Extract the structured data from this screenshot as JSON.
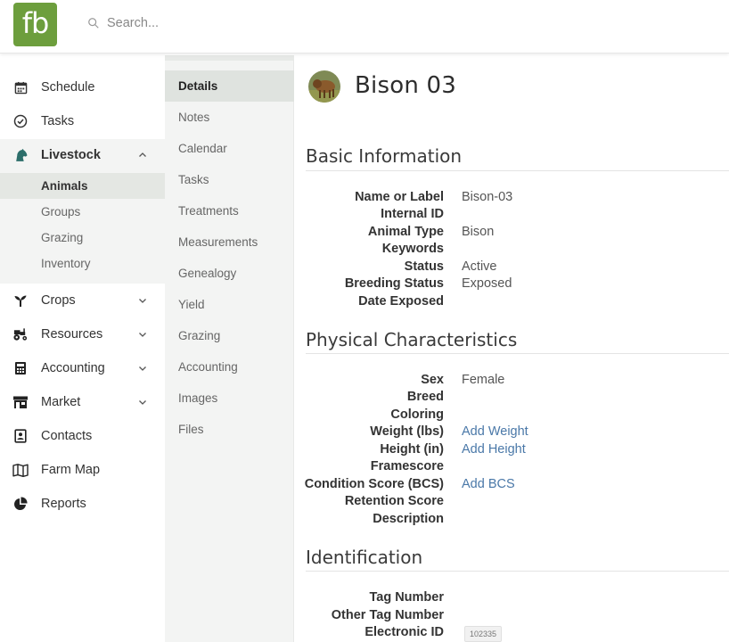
{
  "brand": {
    "logo_text": "fb",
    "color": "#6d9e3d"
  },
  "search": {
    "placeholder": "Search..."
  },
  "nav": {
    "items": [
      {
        "label": "Schedule",
        "icon": "calendar-icon"
      },
      {
        "label": "Tasks",
        "icon": "check-circle-icon"
      },
      {
        "label": "Livestock",
        "icon": "horse-head-icon",
        "expanded": true
      },
      {
        "label": "Crops",
        "icon": "sprout-icon"
      },
      {
        "label": "Resources",
        "icon": "tractor-icon"
      },
      {
        "label": "Accounting",
        "icon": "calculator-icon"
      },
      {
        "label": "Market",
        "icon": "store-icon"
      },
      {
        "label": "Contacts",
        "icon": "contact-card-icon"
      },
      {
        "label": "Farm Map",
        "icon": "map-icon"
      },
      {
        "label": "Reports",
        "icon": "pie-chart-icon"
      }
    ],
    "livestock_sub": [
      "Animals",
      "Groups",
      "Grazing",
      "Inventory"
    ]
  },
  "tabs": [
    "Details",
    "Notes",
    "Calendar",
    "Tasks",
    "Treatments",
    "Measurements",
    "Genealogy",
    "Yield",
    "Grazing",
    "Accounting",
    "Images",
    "Files"
  ],
  "animal": {
    "name": "Bison 03"
  },
  "sections": {
    "basic": {
      "title": "Basic Information",
      "fields": [
        {
          "label": "Name or Label",
          "value": "Bison-03"
        },
        {
          "label": "Internal ID",
          "value": ""
        },
        {
          "label": "Animal Type",
          "value": "Bison"
        },
        {
          "label": "Keywords",
          "value": ""
        },
        {
          "label": "Status",
          "value": "Active"
        },
        {
          "label": "Breeding Status",
          "value": "Exposed"
        },
        {
          "label": "Date Exposed",
          "value": ""
        }
      ]
    },
    "physical": {
      "title": "Physical Characteristics",
      "fields": [
        {
          "label": "Sex",
          "value": "Female"
        },
        {
          "label": "Breed",
          "value": ""
        },
        {
          "label": "Coloring",
          "value": ""
        },
        {
          "label": "Weight (lbs)",
          "value": "Add Weight"
        },
        {
          "label": "Height (in)",
          "value": "Add Height"
        },
        {
          "label": "Framescore",
          "value": ""
        },
        {
          "label": "Condition Score (BCS)",
          "value": "Add BCS"
        },
        {
          "label": "Retention Score",
          "value": ""
        },
        {
          "label": "Description",
          "value": ""
        }
      ]
    },
    "identification": {
      "title": "Identification",
      "fields": [
        {
          "label": "Tag Number",
          "value": ""
        },
        {
          "label": "Other Tag Number",
          "value": ""
        },
        {
          "label": "Electronic ID",
          "value": "102335"
        }
      ]
    }
  }
}
